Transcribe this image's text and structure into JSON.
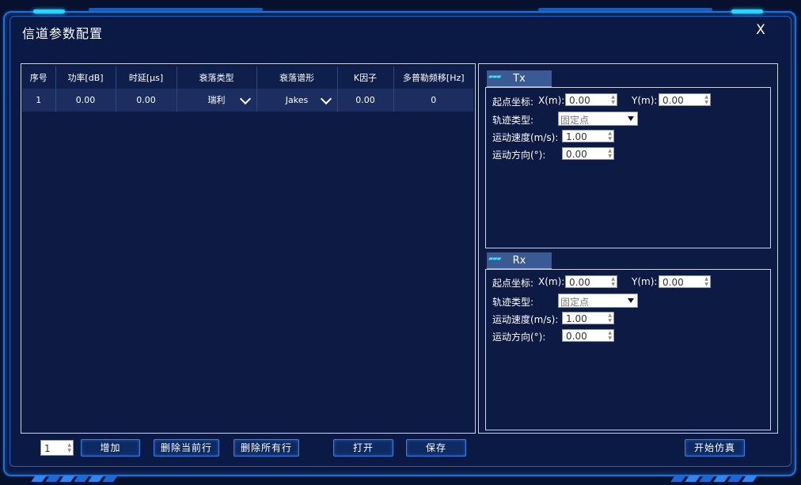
{
  "window": {
    "title": "信道参数配置",
    "close_label": "X"
  },
  "table": {
    "headers": [
      "序号",
      "功率[dB]",
      "时延[μs]",
      "衰落类型",
      "衰落谱形",
      "K因子",
      "多普勒频移[Hz]"
    ],
    "rows": [
      {
        "index": "1",
        "power": "0.00",
        "delay": "0.00",
        "fading_type": "瑞利",
        "fading_spectrum": "Jakes",
        "k_factor": "0.00",
        "doppler": "0"
      }
    ]
  },
  "tx": {
    "tab_label": "Tx",
    "start_label": "起点坐标:",
    "x_label": "X(m):",
    "x_value": "0.00",
    "y_label": "Y(m):",
    "y_value": "0.00",
    "track_label": "轨迹类型:",
    "track_value": "固定点",
    "speed_label": "运动速度(m/s):",
    "speed_value": "1.00",
    "dir_label": "运动方向(°):",
    "dir_value": "0.00"
  },
  "rx": {
    "tab_label": "Rx",
    "start_label": "起点坐标:",
    "x_label": "X(m):",
    "x_value": "0.00",
    "y_label": "Y(m):",
    "y_value": "0.00",
    "track_label": "轨迹类型:",
    "track_value": "固定点",
    "speed_label": "运动速度(m/s):",
    "speed_value": "1.00",
    "dir_label": "运动方向(°):",
    "dir_value": "0.00"
  },
  "toolbar": {
    "count_value": "1",
    "add_label": "增加",
    "delete_current_label": "删除当前行",
    "delete_all_label": "删除所有行",
    "open_label": "打开",
    "save_label": "保存",
    "start_sim_label": "开始仿真"
  },
  "colors": {
    "accent": "#2ad4ff",
    "frame": "#1e6fd6",
    "background": "#0b1a44",
    "selected_row": "#1c2d60"
  }
}
